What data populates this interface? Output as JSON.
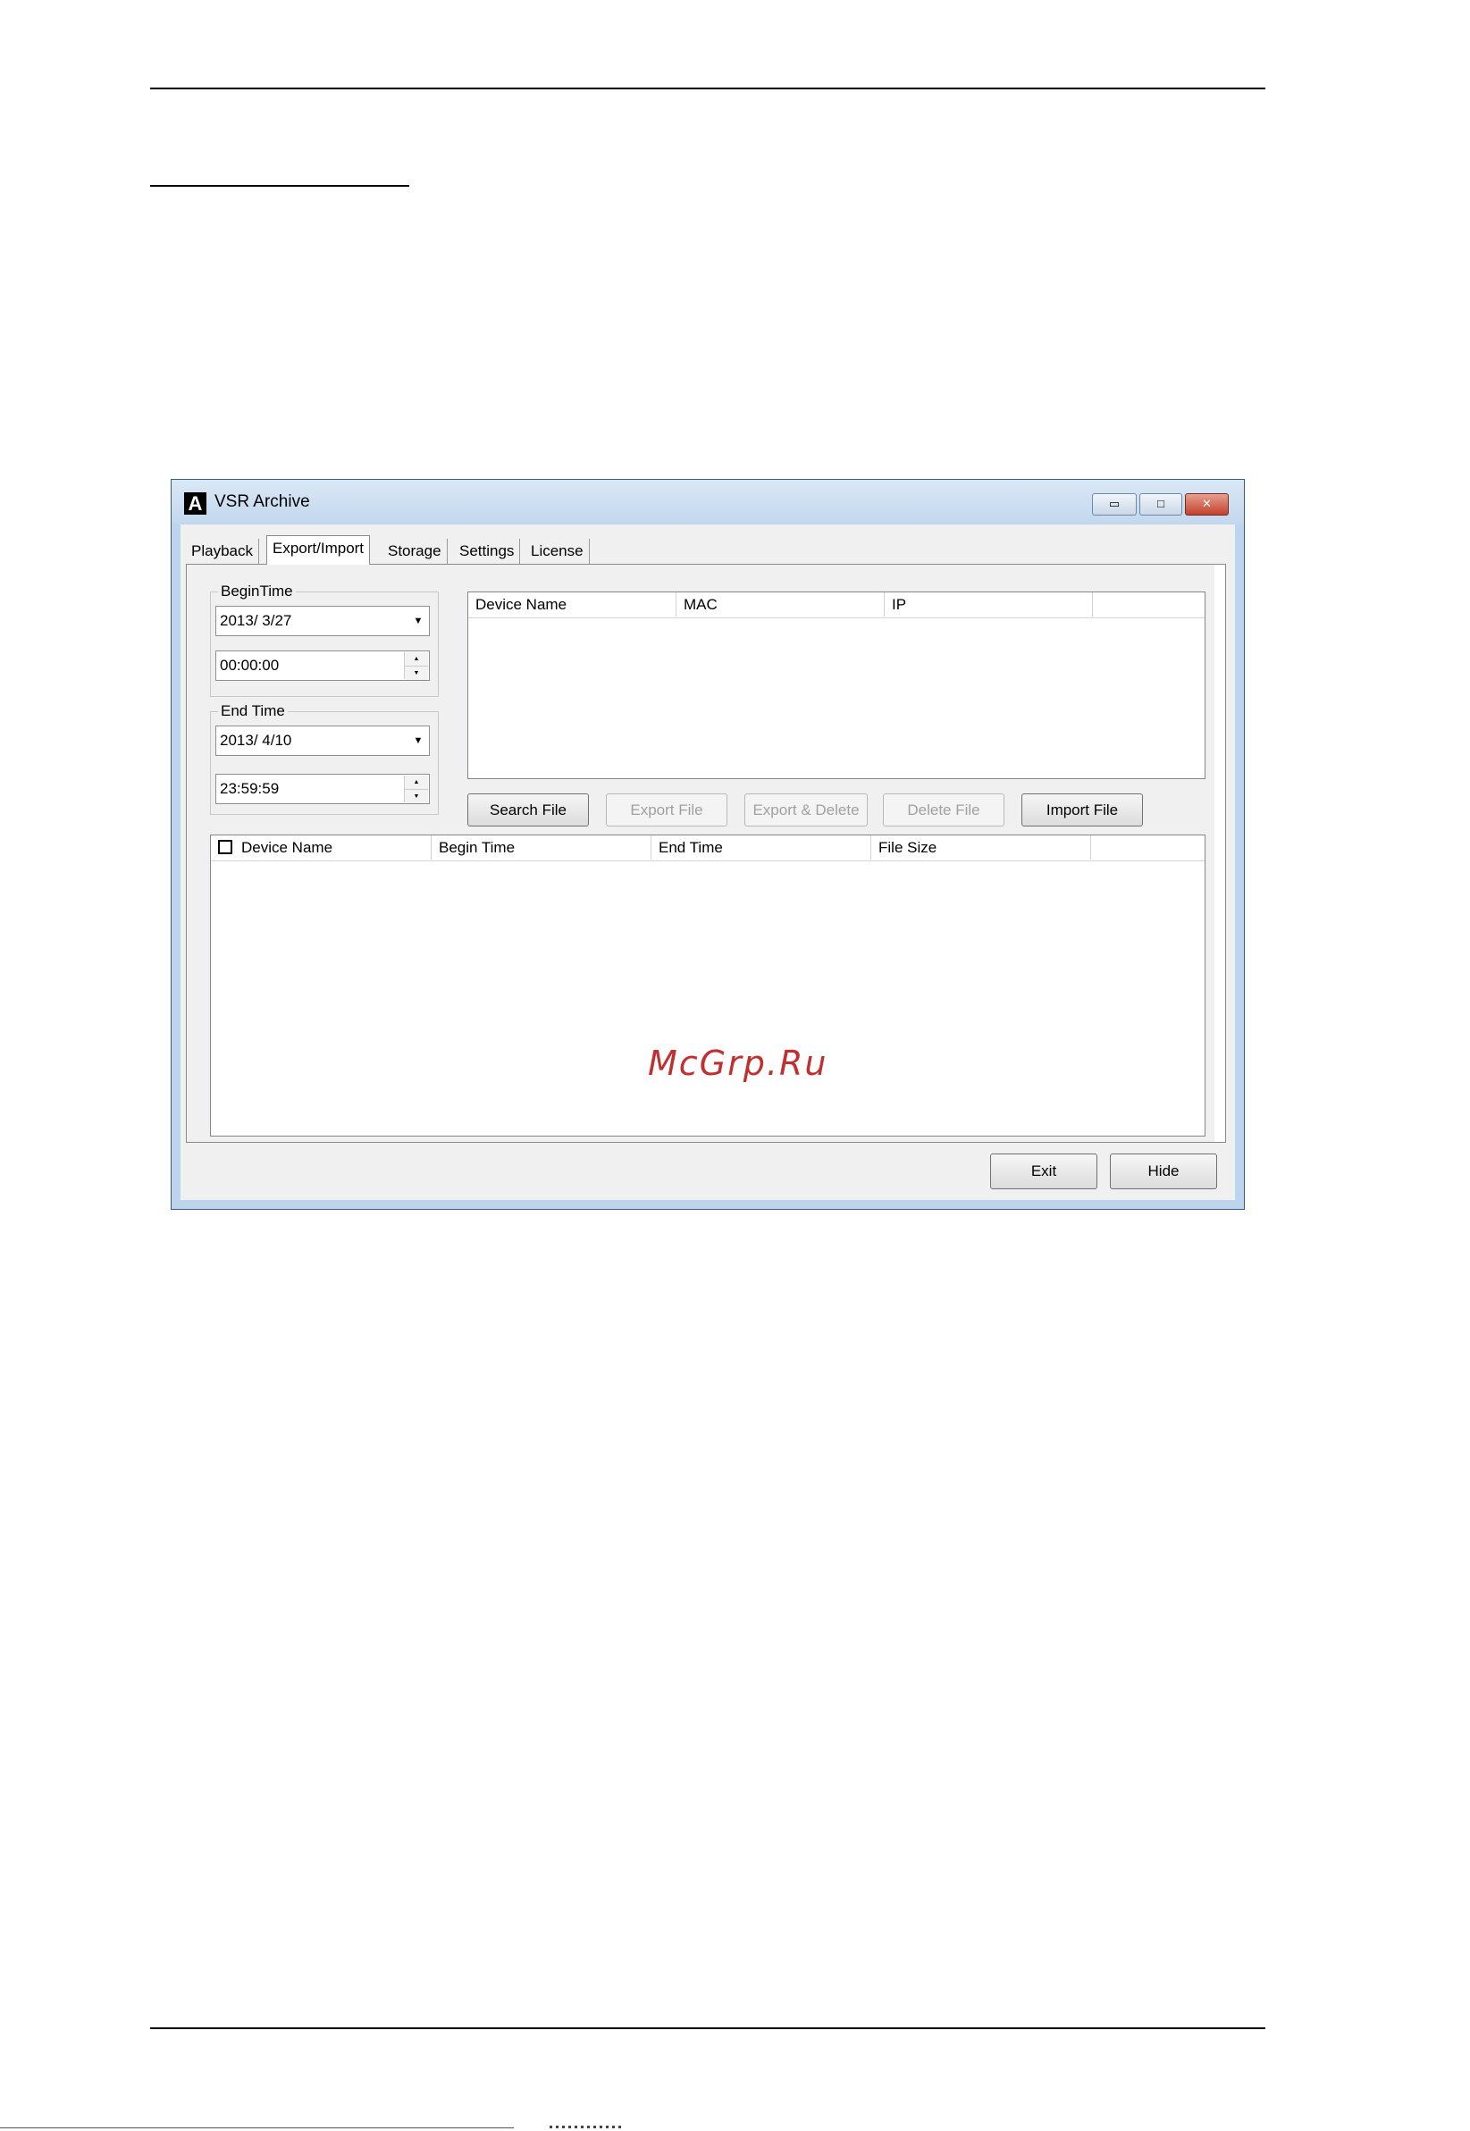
{
  "window": {
    "icon_letter": "A",
    "title": "VSR Archive",
    "min_glyph": "▭",
    "max_glyph": "□",
    "close_glyph": "✕"
  },
  "tabs": [
    {
      "label": "Playback"
    },
    {
      "label": "Export/Import"
    },
    {
      "label": "Storage"
    },
    {
      "label": "Settings"
    },
    {
      "label": "License"
    }
  ],
  "begin_time": {
    "legend": "BeginTime",
    "date": "2013/  3/27",
    "time": "00:00:00"
  },
  "end_time": {
    "legend": "End Time",
    "date": "2013/  4/10",
    "time": "23:59:59"
  },
  "device_list": {
    "columns": [
      "Device Name",
      "MAC",
      "IP",
      ""
    ]
  },
  "actions": {
    "search": "Search File",
    "export": "Export File",
    "export_delete": "Export & Delete",
    "delete": "Delete File",
    "import": "Import File"
  },
  "file_list": {
    "columns": [
      "Device Name",
      "Begin Time",
      "End Time",
      "File Size",
      ""
    ]
  },
  "footer": {
    "exit": "Exit",
    "hide": "Hide"
  },
  "watermark": "McGrp.Ru",
  "icons": {
    "dropdown": "▼",
    "spin_up": "▲",
    "spin_down": "▼"
  }
}
